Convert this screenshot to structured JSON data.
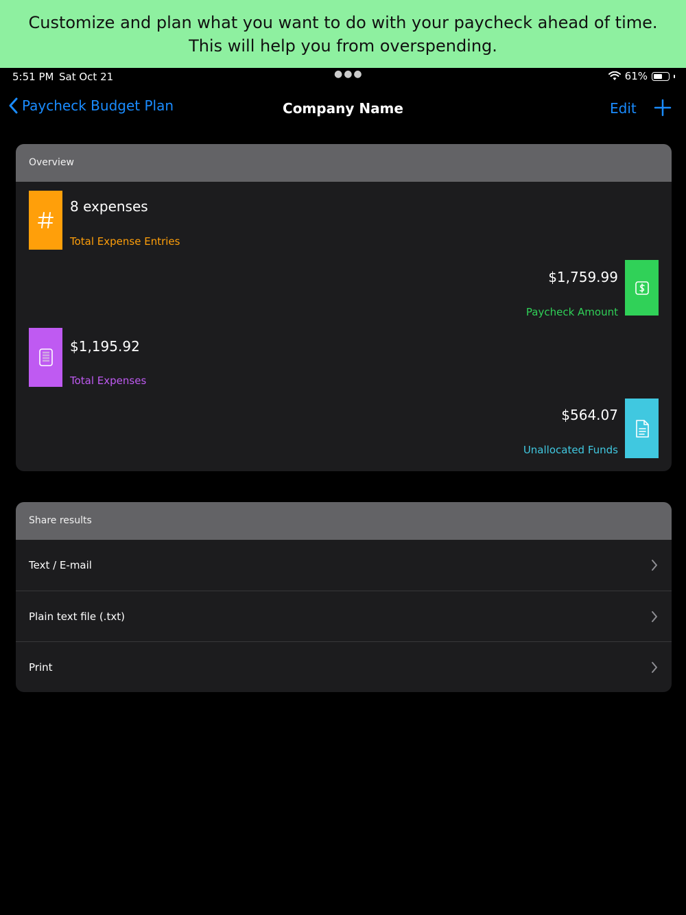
{
  "banner": {
    "line1": "Customize and plan what you want to do with your paycheck ahead of time.",
    "line2": "This will help you from overspending."
  },
  "status_bar": {
    "time": "5:51 PM",
    "date": "Sat Oct 21",
    "battery": "61%",
    "battery_level": 0.61
  },
  "nav": {
    "back_label": "Paycheck Budget Plan",
    "title": "Company Name",
    "edit_label": "Edit"
  },
  "overview": {
    "header": "Overview",
    "stats": [
      {
        "value": "8 expenses",
        "label": "Total Expense Entries",
        "color": "#ff9f0a",
        "icon": "hash-icon"
      },
      {
        "value": "$1,759.99",
        "label": "Paycheck Amount",
        "color": "#30d158",
        "icon": "dollar-icon"
      },
      {
        "value": "$1,195.92",
        "label": "Total Expenses",
        "color": "#bf5af2",
        "icon": "receipt-icon"
      },
      {
        "value": "$564.07",
        "label": "Unallocated Funds",
        "color": "#40c8e0",
        "icon": "document-icon"
      }
    ]
  },
  "share": {
    "header": "Share results",
    "rows": [
      {
        "label": "Text / E-mail"
      },
      {
        "label": "Plain text file (.txt)"
      },
      {
        "label": "Print"
      }
    ]
  },
  "colors": {
    "accent": "#1a8cff",
    "banner": "#8ef0a0",
    "card": "#1c1c1e",
    "card_header": "#636366"
  }
}
